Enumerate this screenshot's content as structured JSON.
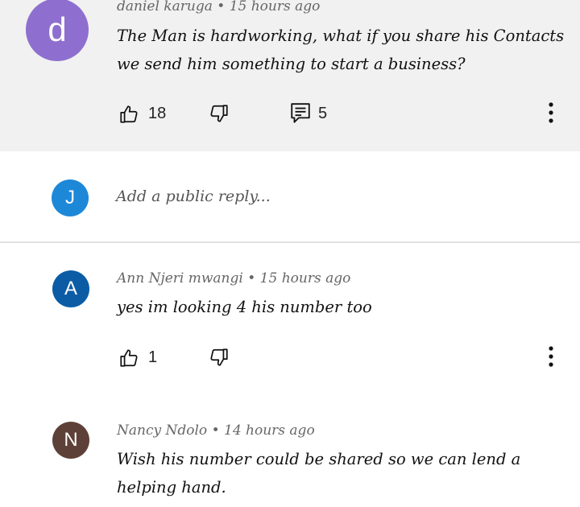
{
  "comment1": {
    "avatar_letter": "d",
    "avatar_color": "#8e6fd0",
    "author": "daniel karuga",
    "time": "15 hours ago",
    "separator": "•",
    "text_line1": "The Man is hardworking, what if you share his Contacts",
    "text_line2": "we send him something to start a business?",
    "likes": "18",
    "replies": "5"
  },
  "reply_box": {
    "avatar_letter": "J",
    "avatar_color": "#1e88d8",
    "placeholder": "Add a public reply..."
  },
  "comment2": {
    "avatar_letter": "A",
    "avatar_color": "#0b5ca5",
    "author": "Ann Njeri mwangi",
    "time": "15 hours ago",
    "separator": "•",
    "text_line1": "yes im looking 4 his number too",
    "likes": "1"
  },
  "comment3": {
    "avatar_letter": "N",
    "avatar_color": "#5d4037",
    "author": "Nancy Ndolo",
    "time": "14 hours ago",
    "separator": "•",
    "text_line1": "Wish his number could be shared so we can lend a",
    "text_line2": "helping hand."
  },
  "icons": {
    "like": "thumb-up-icon",
    "dislike": "thumb-down-icon",
    "replies": "comment-icon",
    "more": "more-vertical-icon"
  }
}
